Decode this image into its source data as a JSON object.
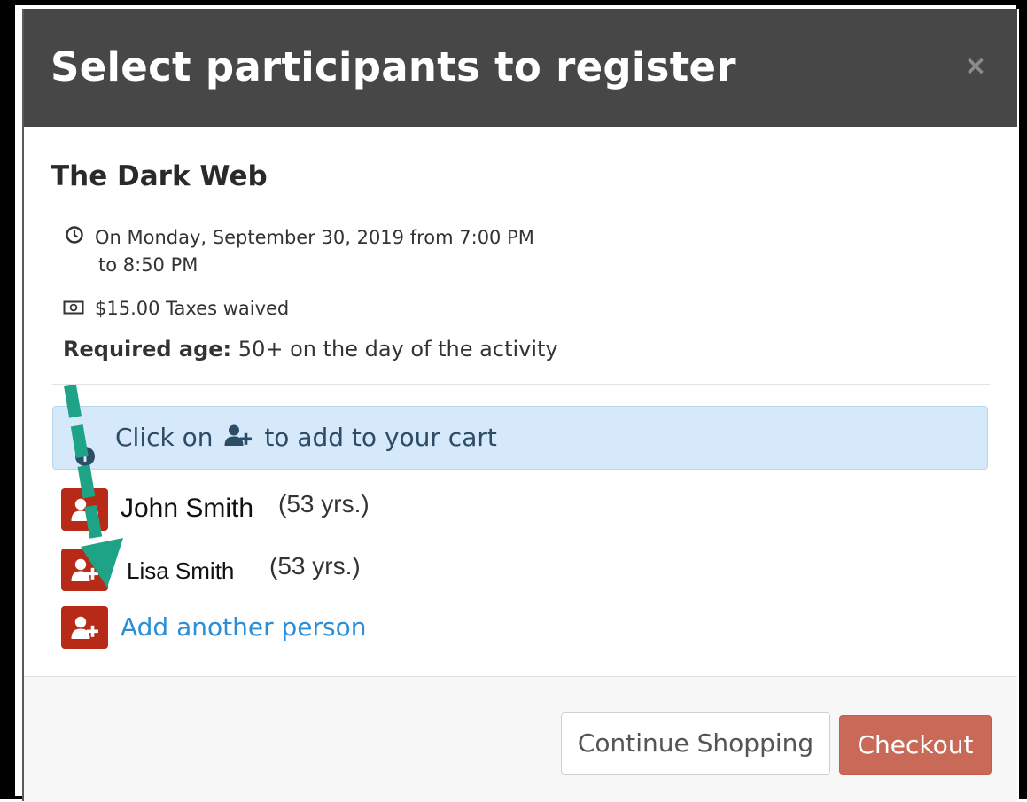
{
  "modal": {
    "title": "Select participants to register",
    "close_symbol": "×"
  },
  "activity": {
    "name": "The Dark Web",
    "when_line1": "On Monday, September 30, 2019 from 7:00 PM",
    "when_line2": "to 8:50 PM",
    "price": "$15.00 Taxes waived",
    "age_label": "Required age:",
    "age_value": "50+ on the day of the activity"
  },
  "alert": {
    "text_before": "Click on",
    "text_after": "to add to your cart"
  },
  "participants": [
    {
      "name": "John Smith",
      "age": "(53 yrs.)"
    },
    {
      "name": "Lisa Smith",
      "age": "(53 yrs.)"
    }
  ],
  "add_another_label": "Add another person",
  "footer": {
    "continue_label": "Continue Shopping",
    "checkout_label": "Checkout"
  },
  "colors": {
    "header_bg": "#474747",
    "add_button": "#b72a17",
    "checkout": "#c96a58",
    "alert_bg": "#d6e9fb",
    "link": "#2a8fd6",
    "annotation_arrow": "#1fa386"
  },
  "icons": {
    "clock": "clock-icon",
    "money": "money-icon",
    "info": "info-icon",
    "add_user": "add-user-icon",
    "close": "close-icon",
    "arrow": "annotation-arrow"
  }
}
